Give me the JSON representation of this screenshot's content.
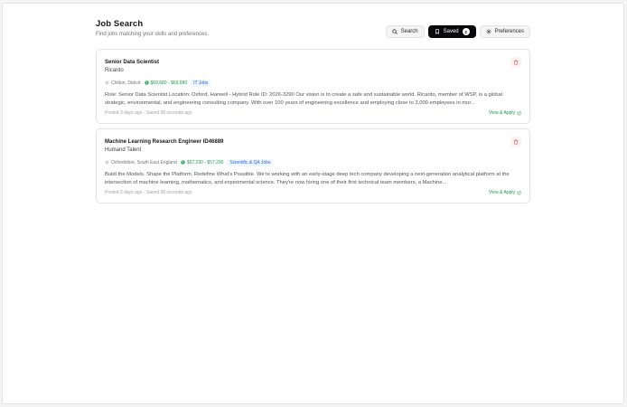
{
  "header": {
    "title": "Job Search",
    "subtitle": "Find jobs matching your skills and preferences."
  },
  "tabs": [
    {
      "label": "Search",
      "icon": "search-icon",
      "active": false
    },
    {
      "label": "Saved",
      "icon": "bookmark-icon",
      "active": true,
      "count": "2"
    },
    {
      "label": "Preferences",
      "icon": "gear-icon",
      "active": false
    }
  ],
  "jobs": [
    {
      "title": "Senior Data Scientist",
      "company": "Ricardo",
      "location": "Chilton, Didcot",
      "salary": "$69,680 - $69,680",
      "category": "IT Jobs",
      "description": "Role: Senior Data Scientist Location: Oxford, Harwell - Hybrid Role ID: 2026-3290 Our vision is to create a safe and sustainable world. Ricardo, member of WSP, is a global strategic, environmental, and engineering consulting company. With over 100 years of engineering excellence and employing close to 3,000 employees in mor...",
      "posted": "Posted 3 days ago",
      "saved": "Saved 28 seconds ago",
      "apply_label": "View & Apply"
    },
    {
      "title": "Machine Learning Research Engineer ID46889",
      "company": "Humand Talent",
      "location": "Oxfordshire, South East England",
      "salary": "$57,290 - $57,290",
      "category": "Scientific & QA Jobs",
      "description": "Build the Models. Shape the Platform. Redefine What's Possible. We're working with an early-stage deep tech company developing a next-generation analytical platform at the intersection of machine learning, mathematics, and experimental science. They're now hiring one of their first technical team members, a Machine...",
      "posted": "Posted 2 days ago",
      "saved": "Saved 28 seconds ago",
      "apply_label": "View & Apply"
    }
  ],
  "colors": {
    "accent": "#09090b",
    "salary": "#16a34a",
    "badge_bg": "#eff6ff",
    "badge_text": "#2563eb",
    "delete": "#ef4444"
  }
}
